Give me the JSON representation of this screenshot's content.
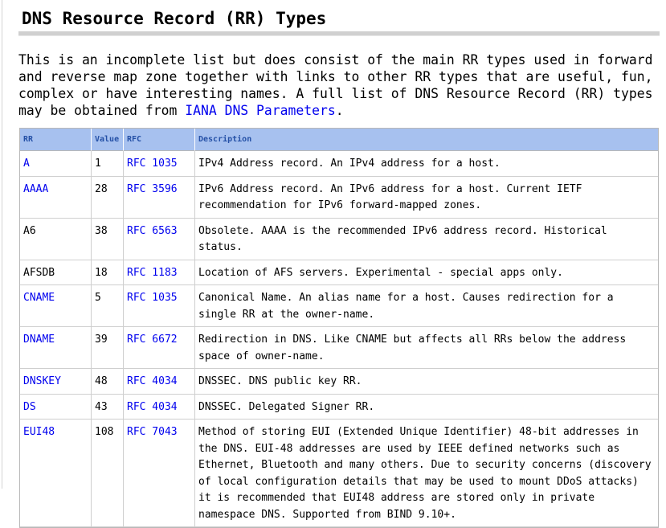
{
  "title": "DNS Resource Record (RR) Types",
  "intro": {
    "text": "This is an incomplete list but does consist of the main RR types used in forward and reverse map zone together with links to other RR types that are useful, fun, complex or have interesting names. A full list of DNS Resource Record (RR) types may be obtained from ",
    "link_text": "IANA DNS Parameters",
    "end": "."
  },
  "table": {
    "headers": {
      "rr": "RR",
      "value": "Value",
      "rfc": "RFC",
      "description": "Description"
    },
    "rows": [
      {
        "rr": "A",
        "rr_link": true,
        "value": "1",
        "rfc": "RFC 1035",
        "description": "IPv4 Address record. An IPv4 address for a host."
      },
      {
        "rr": "AAAA",
        "rr_link": true,
        "value": "28",
        "rfc": "RFC 3596",
        "description": "IPv6 Address record. An IPv6 address for a host. Current IETF recommendation for IPv6 forward-mapped zones."
      },
      {
        "rr": "A6",
        "rr_link": false,
        "value": "38",
        "rfc": "RFC 6563",
        "description": "Obsolete. AAAA is the recommended IPv6 address record. Historical status."
      },
      {
        "rr": "AFSDB",
        "rr_link": false,
        "value": "18",
        "rfc": "RFC 1183",
        "description": "Location of AFS servers. Experimental - special apps only."
      },
      {
        "rr": "CNAME",
        "rr_link": true,
        "value": "5",
        "rfc": "RFC 1035",
        "description": "Canonical Name. An alias name for a host. Causes redirection for a single RR at the owner-name."
      },
      {
        "rr": "DNAME",
        "rr_link": true,
        "value": "39",
        "rfc": "RFC 6672",
        "description": "Redirection in DNS. Like CNAME but affects all RRs below the address space of owner-name."
      },
      {
        "rr": "DNSKEY",
        "rr_link": true,
        "value": "48",
        "rfc": "RFC 4034",
        "description": "DNSSEC. DNS public key RR."
      },
      {
        "rr": "DS",
        "rr_link": true,
        "value": "43",
        "rfc": "RFC 4034",
        "description": "DNSSEC. Delegated Signer RR."
      },
      {
        "rr": "EUI48",
        "rr_link": true,
        "value": "108",
        "rfc": "RFC 7043",
        "description": "Method of storing EUI (Extended Unique Identifier) 48-bit addresses in the DNS. EUI-48 addresses are used by IEEE defined networks such as Ethernet, Bluetooth and many others. Due to security concerns (discovery of local configuration details that may be used to mount DDoS attacks) it is recommended that EUI48 address are stored only in private namespace DNS. Supported from BIND 9.10+."
      }
    ]
  }
}
